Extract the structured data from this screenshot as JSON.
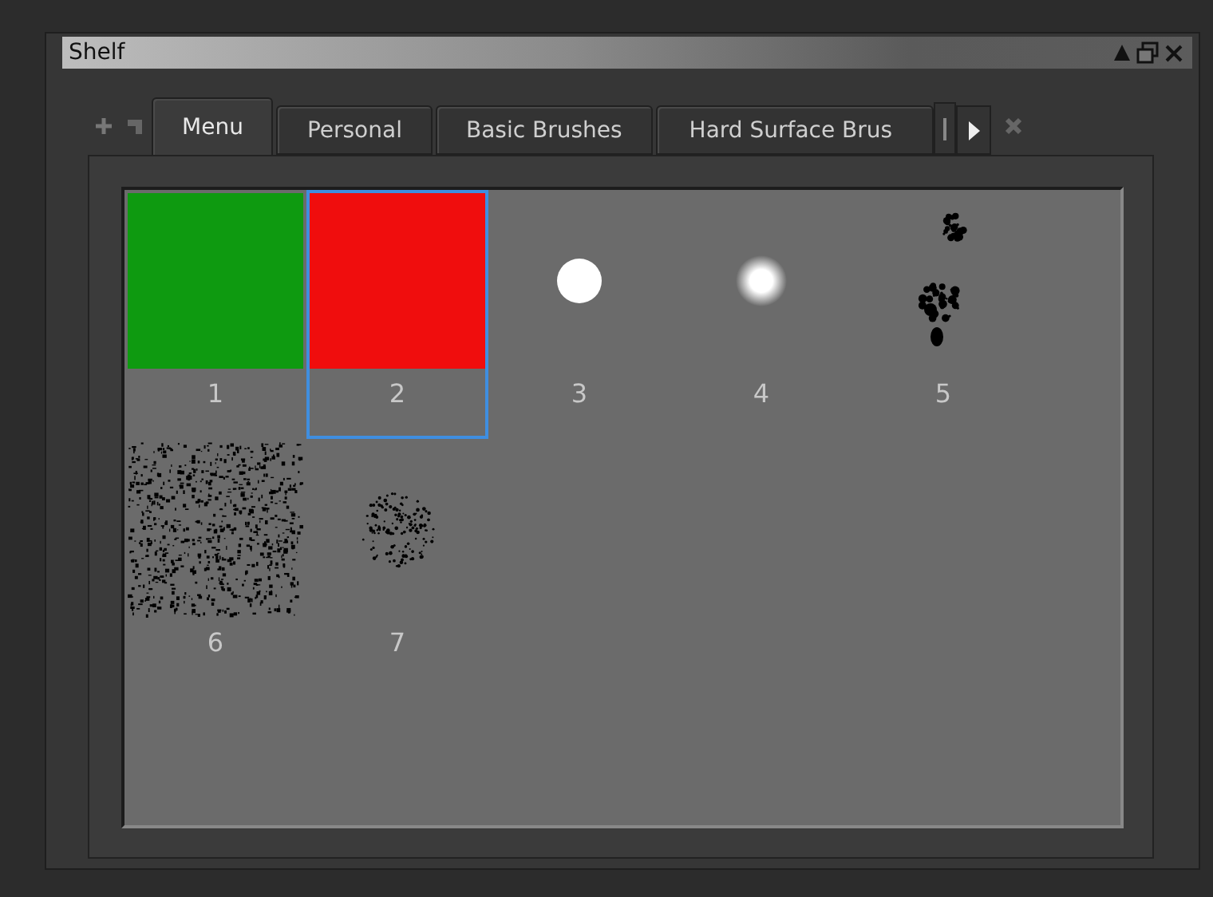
{
  "window": {
    "title": "Shelf"
  },
  "tabs": [
    {
      "label": "Menu",
      "selected": true
    },
    {
      "label": "Personal",
      "selected": false
    },
    {
      "label": "Basic Brushes",
      "selected": false
    },
    {
      "label": "Hard Surface Brus",
      "selected": false
    }
  ],
  "brushes": [
    {
      "label": "1",
      "kind": "swatch",
      "color": "#0e9a10",
      "selected": false
    },
    {
      "label": "2",
      "kind": "swatch",
      "color": "#f00d0d",
      "selected": true
    },
    {
      "label": "3",
      "kind": "hard-dot",
      "selected": false
    },
    {
      "label": "4",
      "kind": "soft-dot",
      "selected": false
    },
    {
      "label": "5",
      "kind": "splatter",
      "selected": false
    },
    {
      "label": "6",
      "kind": "noise",
      "selected": false
    },
    {
      "label": "7",
      "kind": "speckle",
      "selected": false
    }
  ]
}
